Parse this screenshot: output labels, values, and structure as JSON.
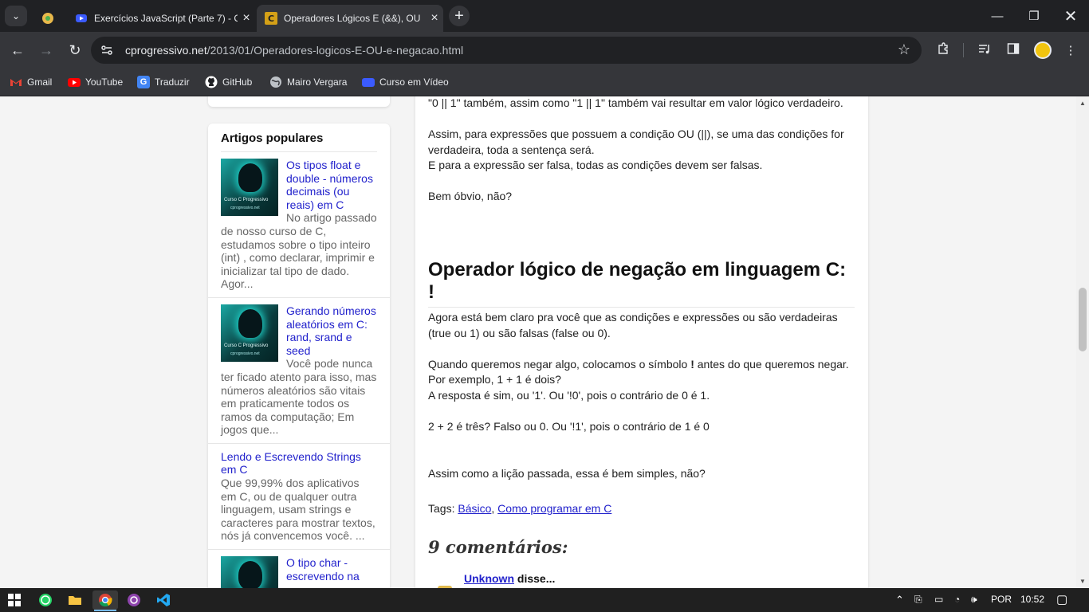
{
  "browser": {
    "tabs": [
      {
        "title": "",
        "favicon_color": "#e8b84b",
        "active": false
      },
      {
        "title": "Exercícios JavaScript (Parte 7) - C",
        "favicon_color": "#3b5bff",
        "active": false
      },
      {
        "title": "Operadores Lógicos E (&&), OU",
        "favicon_color": "#d4a017",
        "active": true
      }
    ],
    "url_host": "cprogressivo.net",
    "url_path": "/2013/01/Operadores-logicos-E-OU-e-negacao.html",
    "bookmarks": [
      {
        "label": "Gmail",
        "icon": "gmail-icon",
        "color": "#ea4335"
      },
      {
        "label": "YouTube",
        "icon": "youtube-icon",
        "color": "#ff0000"
      },
      {
        "label": "Traduzir",
        "icon": "translate-icon",
        "color": "#4285f4"
      },
      {
        "label": "GitHub",
        "icon": "github-icon",
        "color": "#ffffff"
      },
      {
        "label": "Mairo Vergara",
        "icon": "globe-icon",
        "color": "#bdc1c6"
      },
      {
        "label": "Curso em Vídeo",
        "icon": "video-icon",
        "color": "#3b5bff"
      }
    ]
  },
  "sidebar": {
    "popular_title": "Artigos populares",
    "thumb_caption": "Curso C Progressivo",
    "thumb_sub": "cprogressivo.net",
    "items": [
      {
        "link": "Os tipos float e double - números decimais (ou reais) em C",
        "snippet": "No artigo passado de nosso curso de C, estudamos sobre o tipo inteiro (int) , como declarar, imprimir e inicializar tal tipo de dado. Agor...",
        "has_thumb": true
      },
      {
        "link": "Gerando números aleatórios em C: rand, srand e seed",
        "snippet": "Você pode nunca ter ficado atento para isso, mas números aleatórios são vitais em praticamente todos os ramos da computação; Em jogos que...",
        "has_thumb": true
      },
      {
        "link": "Lendo e Escrevendo Strings em C",
        "snippet": "Que 99,99% dos aplicativos em C, ou de qualquer outra linguagem, usam strings e caracteres para mostrar textos, nós já convencemos você. ...",
        "has_thumb": false
      },
      {
        "link": "O tipo char - escrevendo na",
        "snippet": "",
        "has_thumb": true
      }
    ]
  },
  "article": {
    "p1": "\"0 || 1\" também, assim como \"1 || 1\" também vai resultar em valor lógico verdadeiro.",
    "p2a": "Assim, para expressões que possuem a condição OU (||), se uma das condições for verdadeira, toda a sentença será.",
    "p2b": "E para a expressão ser falsa, todas as condições devem ser falsas.",
    "p3": "Bem óbvio, não?",
    "heading": "Operador lógico de negação em linguagem C: !",
    "p4": "Agora está bem claro pra você que as condições e expressões ou são verdadeiras (true ou 1) ou são falsas (false ou 0).",
    "p5a_before": "Quando queremos negar algo, colocamos o símbolo ",
    "p5a_bold": "!",
    "p5a_after": " antes do que queremos negar.",
    "p5b": "Por exemplo, 1 + 1 é dois?",
    "p5c": "A resposta é sim, ou '1'. Ou '!0', pois o contrário de 0 é 1.",
    "p6": "2 + 2 é três? Falso ou 0. Ou '!1', pois o contrário de 1 é 0",
    "p7": "Assim como a lição passada, essa é bem simples, não?",
    "tags_label": "Tags: ",
    "tag1": "Básico",
    "tag_sep": ", ",
    "tag2": "Como programar em C",
    "comments_heading": "9 comentários:",
    "comment_author": "Unknown",
    "comment_said": " disse..."
  },
  "taskbar": {
    "lang": "POR",
    "time": "10:52"
  }
}
